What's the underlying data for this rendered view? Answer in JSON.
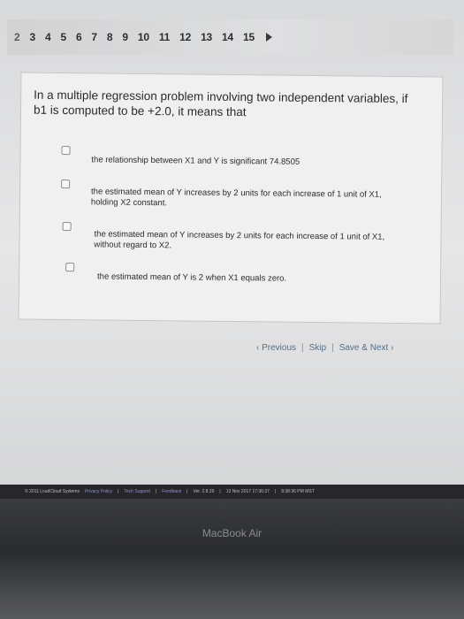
{
  "pager": {
    "pages": [
      "2",
      "3",
      "4",
      "5",
      "6",
      "7",
      "8",
      "9",
      "10",
      "11",
      "12",
      "13",
      "14",
      "15"
    ],
    "current_index": 0
  },
  "question": {
    "text": "In a multiple regression problem involving two independent variables, if b1 is computed to be +2.0, it means that",
    "options": [
      "the relationship between X1 and Y is significant 74.8505",
      "the estimated mean of Y increases by 2 units for each increase of 1 unit of X1, holding X2 constant.",
      "the estimated mean of Y increases by 2 units for each increase of 1 unit of X1, without regard to X2.",
      "the estimated mean of Y is 2 when X1 equals zero."
    ]
  },
  "nav": {
    "previous": "Previous",
    "skip": "Skip",
    "save_next": "Save & Next"
  },
  "footer": {
    "copyright": "© 2011 LoudCloud Systems",
    "privacy": "Privacy Policy",
    "tech_support": "Tech Support",
    "feedback": "Feedback",
    "version": "Ver. 2.8.29",
    "build": "13 Nov 2017 17:36:37",
    "time": "8:38:36 PM MST"
  },
  "device": {
    "brand": "MacBook Air"
  }
}
